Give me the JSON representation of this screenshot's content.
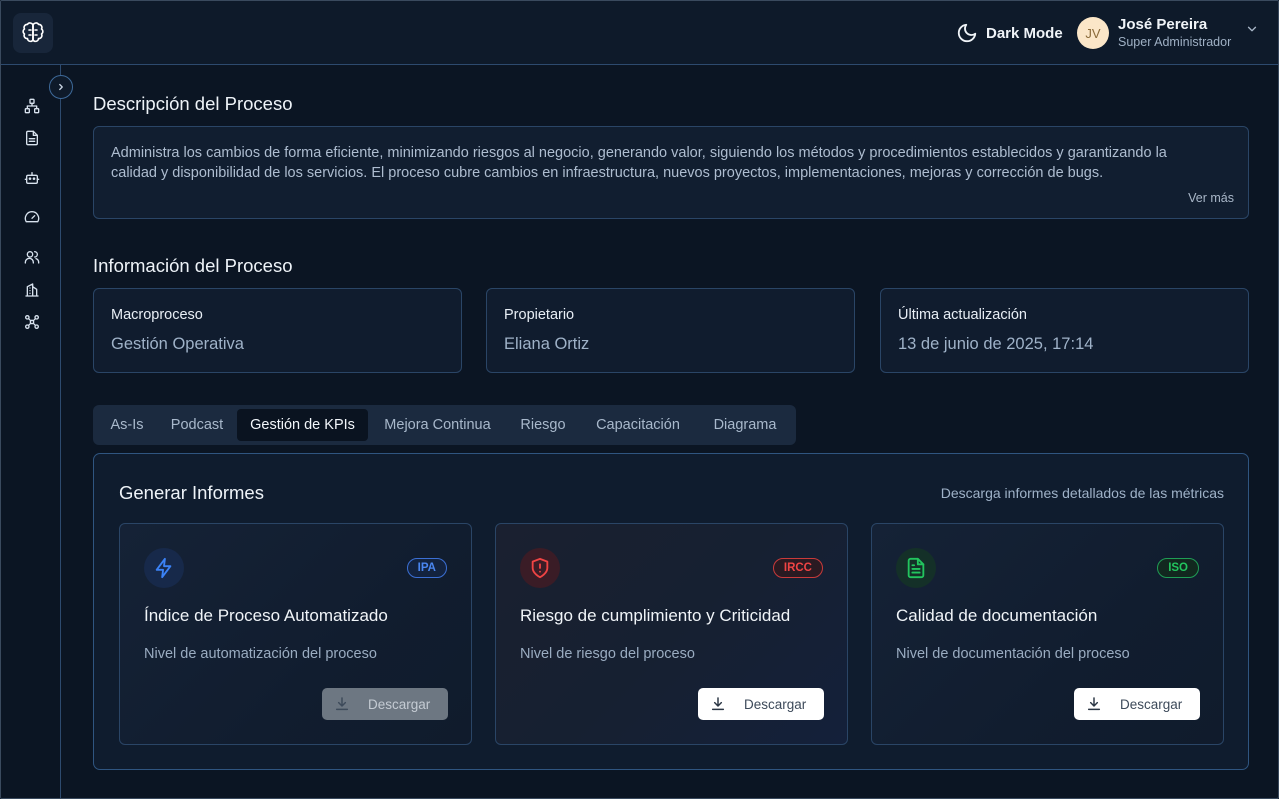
{
  "header": {
    "dark_mode_label": "Dark Mode",
    "user": {
      "initials": "JV",
      "name": "José Pereira",
      "role": "Super Administrador"
    }
  },
  "sidebar": {
    "icons": [
      "org-chart-icon",
      "document-icon",
      "robot-icon",
      "gauge-icon",
      "users-icon",
      "building-icon",
      "network-icon"
    ]
  },
  "description": {
    "title": "Descripción del Proceso",
    "text": "Administra los cambios de forma eficiente, minimizando riesgos al negocio, generando valor, siguiendo los métodos y procedimientos establecidos y garantizando la calidad y disponibilidad de los servicios. El proceso cubre cambios en infraestructura, nuevos proyectos, implementaciones, mejoras y corrección de bugs.",
    "more_label": "Ver más"
  },
  "info": {
    "title": "Información del Proceso",
    "cards": [
      {
        "label": "Macroproceso",
        "value": "Gestión Operativa"
      },
      {
        "label": "Propietario",
        "value": "Eliana Ortiz"
      },
      {
        "label": "Última actualización",
        "value": "13 de junio de 2025, 17:14"
      }
    ]
  },
  "tabs": [
    {
      "label": "As-Is",
      "active": false
    },
    {
      "label": "Podcast",
      "active": false
    },
    {
      "label": "Gestión de KPIs",
      "active": true
    },
    {
      "label": "Mejora Continua",
      "active": false
    },
    {
      "label": "Riesgo",
      "active": false
    },
    {
      "label": "Capacitación",
      "active": false
    },
    {
      "label": "Diagrama",
      "active": false
    }
  ],
  "reports": {
    "title": "Generar Informes",
    "subtitle": "Descarga informes detallados de las métricas",
    "cards": [
      {
        "badge": "IPA",
        "title": "Índice de Proceso Automatizado",
        "description": "Nivel de automatización del proceso",
        "button_label": "Descargar",
        "button_disabled": true,
        "icon": "lightning-icon",
        "accent": "#3b82f6"
      },
      {
        "badge": "IRCC",
        "title": "Riesgo de cumplimiento y Criticidad",
        "description": "Nivel de riesgo del proceso",
        "button_label": "Descargar",
        "button_disabled": false,
        "icon": "shield-alert-icon",
        "accent": "#ef4444"
      },
      {
        "badge": "ISO",
        "title": "Calidad de documentación",
        "description": "Nivel de documentación del proceso",
        "button_label": "Descargar",
        "button_disabled": false,
        "icon": "file-text-icon",
        "accent": "#22c55e"
      }
    ]
  },
  "colors": {
    "background": "#0b1523",
    "border_accent": "#2f5580",
    "blue": "#3b82f6",
    "red": "#ef4444",
    "green": "#22c55e"
  }
}
